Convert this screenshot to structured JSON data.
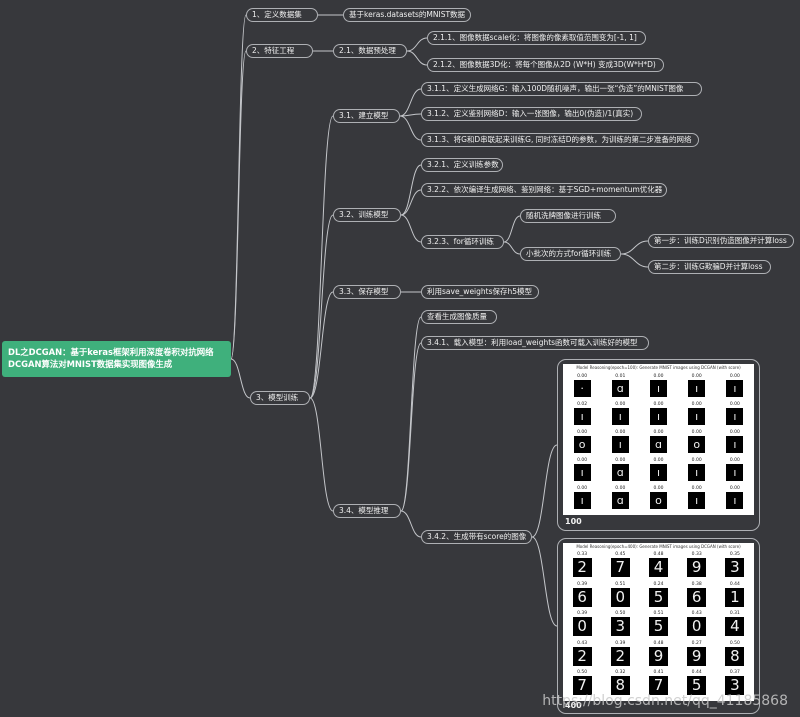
{
  "root": {
    "label": "DL之DCGAN：基于keras框架利用深度卷积对抗网络DCGAN算法对MNIST数据集实现图像生成"
  },
  "nodes": {
    "n1": "1、定义数据集",
    "n1a": "基于keras.datasets的MNIST数据",
    "n2": "2、特征工程",
    "n21": "2.1、数据预处理",
    "n211": "2.1.1、图像数据scale化：将图像的像素取值范围变为[-1, 1]",
    "n212": "2.1.2、图像数据3D化：将每个图像从2D (W*H) 变成3D(W*H*D)",
    "n3": "3、模型训练",
    "n31": "3.1、建立模型",
    "n311": "3.1.1、定义生成网络G：输入100D随机噪声，输出一张“伪造”的MNIST图像",
    "n312": "3.1.2、定义鉴别网络D：输入一张图像，输出0(伪造)/1(真实)",
    "n313": "3.1.3、将G和D串联起来训练G, 同时冻结D的参数，为训练的第二步准备的网络",
    "n32": "3.2、训练模型",
    "n321": "3.2.1、定义训练参数",
    "n322": "3.2.2、依次编译生成网络、鉴别网络：基于SGD+momentum优化器",
    "n323": "3.2.3、for循环训练",
    "n323a": "随机洗牌图像进行训练",
    "n323b": "小批次的方式for循环训练",
    "n323b1": "第一步：训练D识别伪造图像并计算loss",
    "n323b2": "第二步：训练G欺骗D并计算loss",
    "n33": "3.3、保存模型",
    "n33a": "利用save_weights保存h5模型",
    "n34": "3.4、模型推理",
    "n34a": "查看生成图像质量",
    "n341": "3.4.1、载入模型：利用load_weights函数可载入训练好的模型",
    "n342": "3.4.2、生成带有score的图像"
  },
  "figures": [
    {
      "title": "Model Reasoning(epoch=100): Generate MNIST images using DCGAN (with score)",
      "caption": "100",
      "scores": [
        [
          "0.00",
          "0.01",
          "0.00",
          "0.00",
          "0.00"
        ],
        [
          "0.02",
          "0.00",
          "0.00",
          "0.00",
          "0.00"
        ],
        [
          "0.00",
          "0.00",
          "0.00",
          "0.00",
          "0.00"
        ],
        [
          "0.00",
          "0.00",
          "0.00",
          "0.00",
          "0.00"
        ],
        [
          "0.00",
          "0.00",
          "0.00",
          "0.00",
          "0.00"
        ]
      ],
      "glyphs": [
        [
          "·",
          "ɑ",
          "ı",
          "ı",
          "ı"
        ],
        [
          "ı",
          "ı",
          "ı",
          "ı",
          "ı"
        ],
        [
          "o",
          "ı",
          "ɑ",
          "o",
          "ı"
        ],
        [
          "ı",
          "ɑ",
          "ı",
          "ı",
          "ı"
        ],
        [
          "ı",
          "ɑ",
          "o",
          "ı",
          "ı"
        ]
      ]
    },
    {
      "title": "Model Reasoning(epoch=400): Generate MNIST images using DCGAN (with score)",
      "caption": "400",
      "scores": [
        [
          "0.33",
          "0.45",
          "0.48",
          "0.33",
          "0.35"
        ],
        [
          "0.39",
          "0.51",
          "0.24",
          "0.38",
          "0.44"
        ],
        [
          "0.39",
          "0.50",
          "0.51",
          "0.43",
          "0.31"
        ],
        [
          "0.43",
          "0.39",
          "0.48",
          "0.27",
          "0.50"
        ],
        [
          "0.50",
          "0.32",
          "0.41",
          "0.44",
          "0.37"
        ]
      ],
      "glyphs": [
        [
          "2",
          "7",
          "4",
          "9",
          "3"
        ],
        [
          "6",
          "0",
          "5",
          "6",
          "1"
        ],
        [
          "0",
          "3",
          "5",
          "0",
          "4"
        ],
        [
          "2",
          "2",
          "9",
          "9",
          "8"
        ],
        [
          "7",
          "8",
          "7",
          "5",
          "3"
        ]
      ]
    }
  ],
  "watermark": "https://blog.csdn.net/qq_41185868"
}
